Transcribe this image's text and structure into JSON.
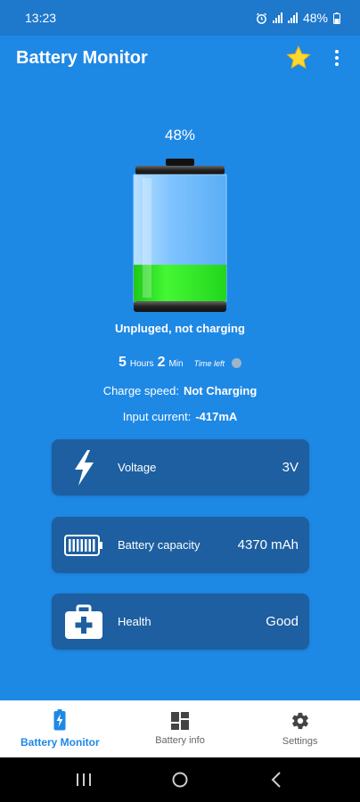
{
  "status_bar": {
    "time": "13:23",
    "battery": "48%"
  },
  "app_bar": {
    "title": "Battery Monitor"
  },
  "battery": {
    "percent_text": "48%",
    "level": 0.48,
    "state": "Unpluged, not charging",
    "fill_color": "#33ee22"
  },
  "time_left": {
    "hours": "5",
    "hours_unit": "Hours",
    "minutes": "2",
    "minutes_unit": "Min",
    "label": "Time left"
  },
  "charge_speed": {
    "label": "Charge speed:",
    "value": "Not Charging"
  },
  "input_current": {
    "label": "Input current:",
    "value": "-417mA"
  },
  "cards": [
    {
      "label": "Voltage",
      "value": "3V",
      "icon": "lightning-icon"
    },
    {
      "label": "Battery capacity",
      "value": "4370 mAh",
      "icon": "battery-capacity-icon"
    },
    {
      "label": "Health",
      "value": "Good",
      "icon": "health-kit-icon"
    }
  ],
  "bottom_nav": [
    {
      "label": "Battery Monitor",
      "icon": "battery-bolt-icon",
      "active": true
    },
    {
      "label": "Battery info",
      "icon": "grid-icon",
      "active": false
    },
    {
      "label": "Settings",
      "icon": "gear-icon",
      "active": false
    }
  ],
  "colors": {
    "background": "#1e88e5",
    "card": "#1d5fa0",
    "accent_star": "#fdd835"
  }
}
